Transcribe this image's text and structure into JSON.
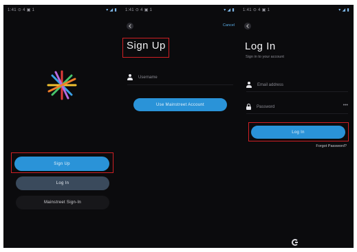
{
  "screen1": {
    "status_left": "1:41 ⊙ 4 ▣ 1",
    "status_right": "▾ ◢ ▮",
    "logo": "colorful-asterisk-logo",
    "signup_button": "Sign Up",
    "login_button": "Log In",
    "mainstreet_button": "Mainstreet Sign-In"
  },
  "screen2": {
    "status_left": "1:41 ⊙ 4 ▣ 1",
    "status_right": "▾ ◢ ▮",
    "cancel_label": "Cancel",
    "title": "Sign Up",
    "username_placeholder": "Username",
    "cta_button": "Use Mainstreet Account"
  },
  "screen3": {
    "status_left": "1:41 ⊙ 4 ▣ 1",
    "status_right": "▾ ◢ ▮",
    "title": "Log In",
    "subtitle": "Sign in to your account",
    "email_placeholder": "Email address",
    "password_placeholder": "Password",
    "show_password": "•••",
    "login_button": "Log In",
    "forgot_link": "Forgot Password?",
    "bottom_icon": "g-icon"
  },
  "colors": {
    "accent_blue": "#2a93d8",
    "highlight_red": "#d01f24",
    "background": "#0b0b0d"
  }
}
